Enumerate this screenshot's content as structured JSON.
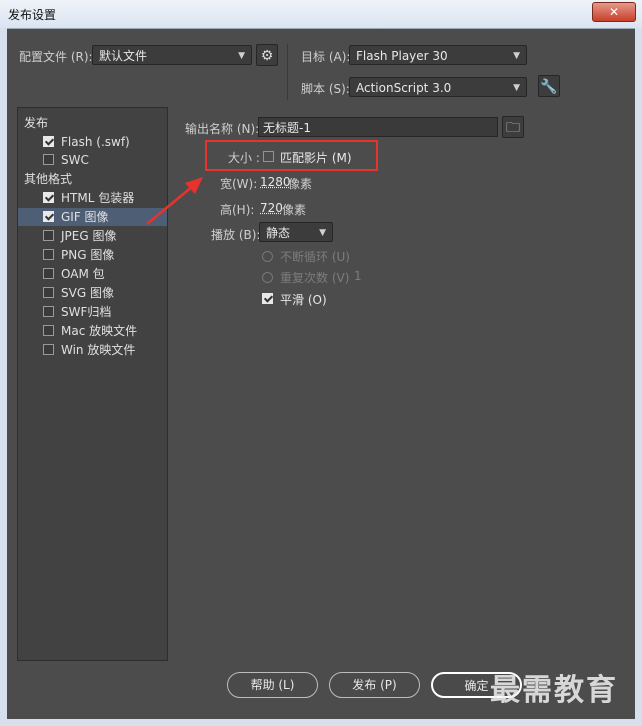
{
  "window": {
    "title": "发布设置",
    "close_label": "✕"
  },
  "top": {
    "profile_label": "配置文件 (R):",
    "profile_value": "默认文件",
    "target_label": "目标 (A):",
    "target_value": "Flash Player 30",
    "script_label": "脚本 (S):",
    "script_value": "ActionScript 3.0"
  },
  "tree": {
    "publish_header": "发布",
    "other_header": "其他格式",
    "items": [
      {
        "label": "Flash (.swf)",
        "checked": true
      },
      {
        "label": "SWC",
        "checked": false
      },
      {
        "label": "HTML 包装器",
        "checked": true
      },
      {
        "label": "GIF 图像",
        "checked": true
      },
      {
        "label": "JPEG 图像",
        "checked": false
      },
      {
        "label": "PNG 图像",
        "checked": false
      },
      {
        "label": "OAM 包",
        "checked": false
      },
      {
        "label": "SVG 图像",
        "checked": false
      },
      {
        "label": "SWF归档",
        "checked": false
      },
      {
        "label": "Mac 放映文件",
        "checked": false
      },
      {
        "label": "Win 放映文件",
        "checked": false
      }
    ]
  },
  "gif": {
    "output_label": "输出名称 (N):",
    "output_value": "无标题-1",
    "size_label": "大小 :",
    "match_movie_label": "匹配影片 (M)",
    "width_label": "宽(W):",
    "width_value": "1280",
    "width_unit": "像素",
    "height_label": "高(H):",
    "height_value": "720",
    "height_unit": "像素",
    "playback_label": "播放 (B):",
    "playback_value": "静态",
    "loop_label": "不断循环 (U)",
    "repeat_label": "重复次数 (V)",
    "repeat_value": "1",
    "smooth_label": "平滑 (O)"
  },
  "buttons": {
    "help": "帮助 (L)",
    "publish": "发布 (P)",
    "ok": "确定"
  },
  "watermark": "最需教育"
}
